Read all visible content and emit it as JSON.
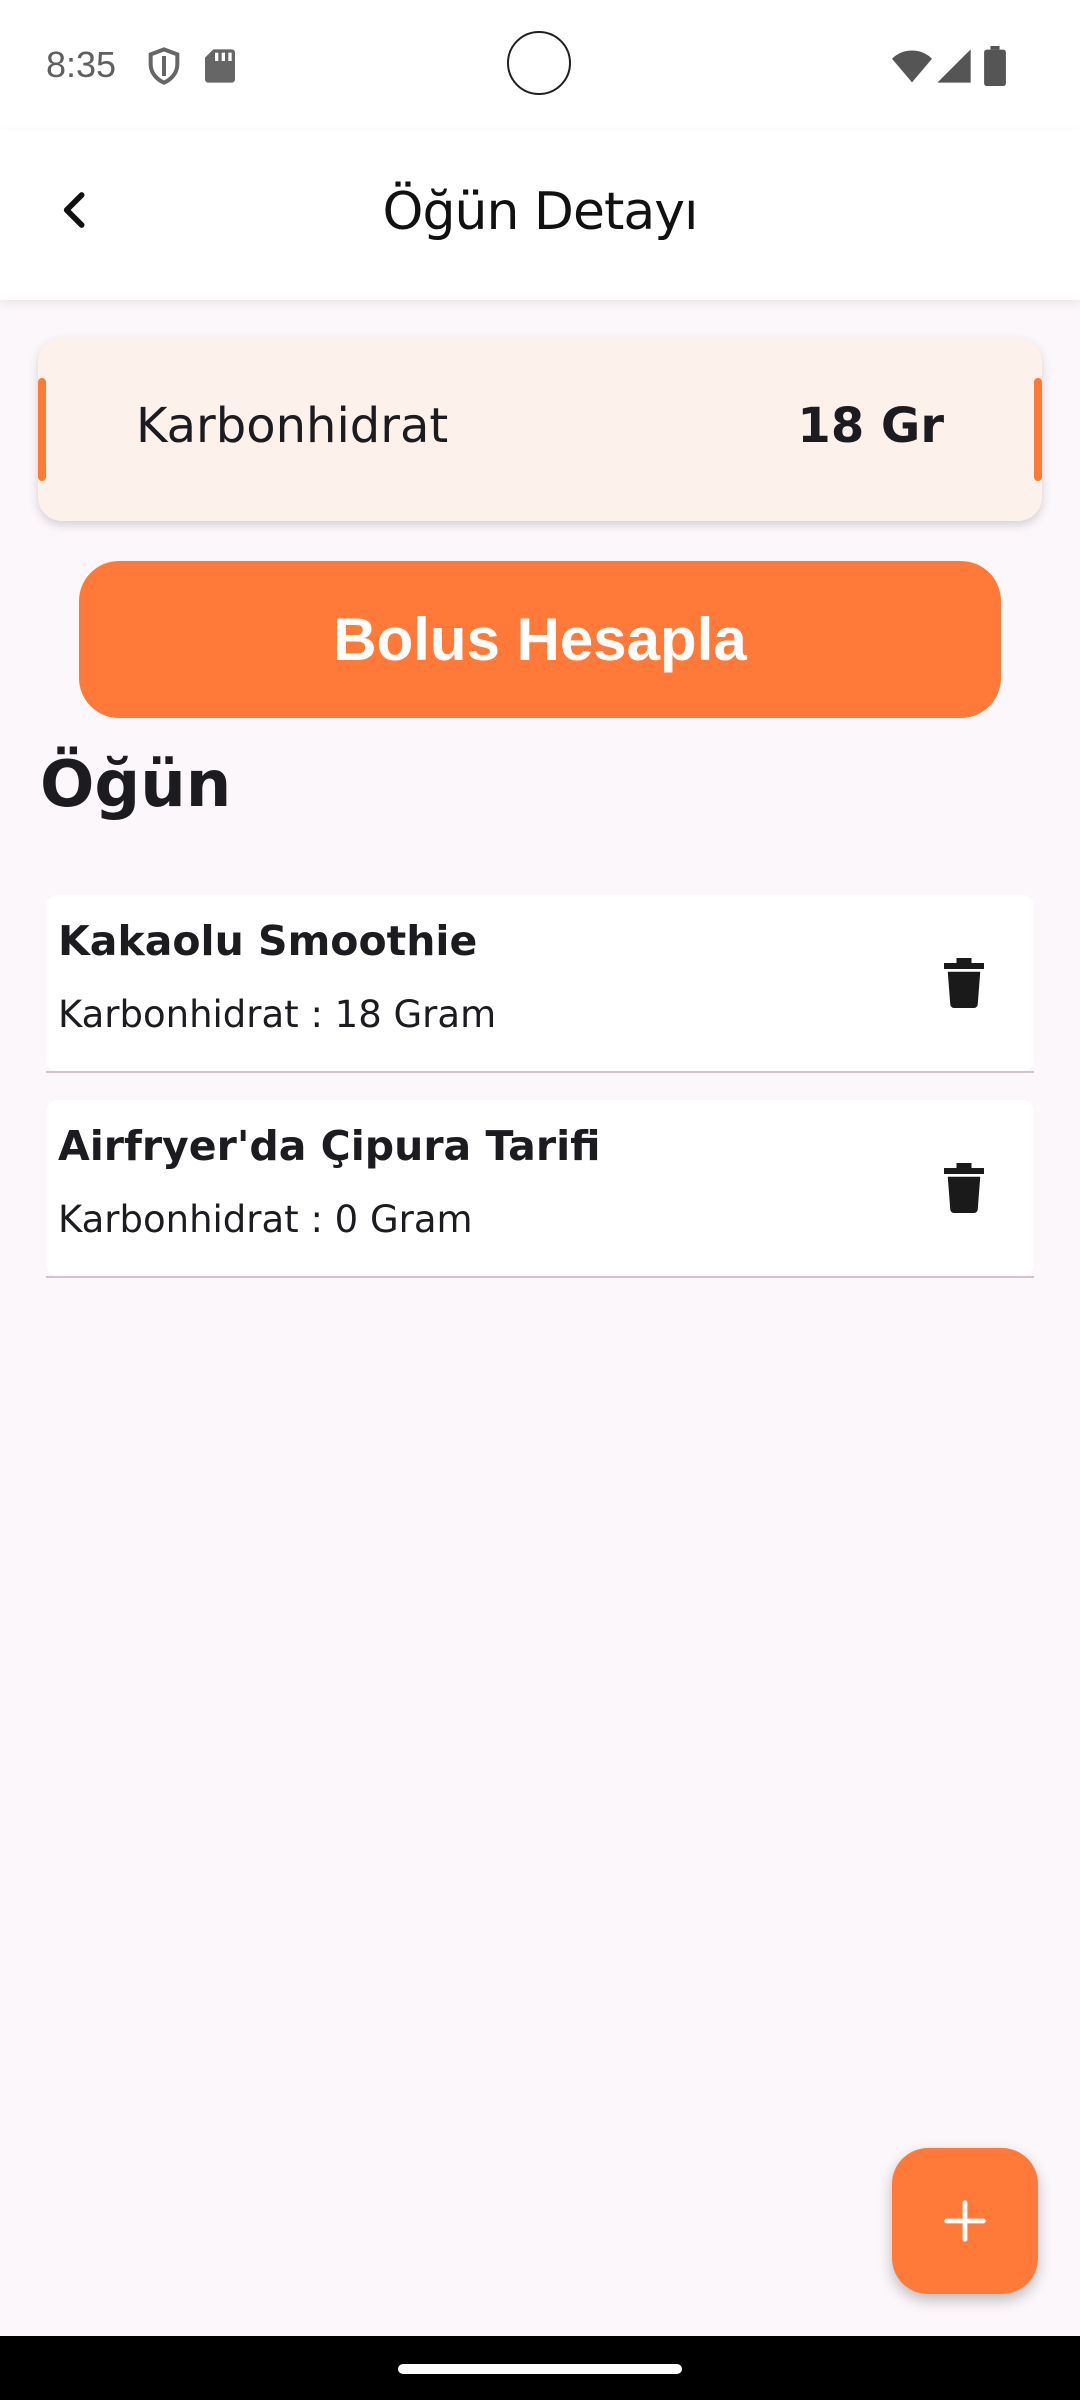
{
  "status_bar": {
    "time": "8:35",
    "icons": [
      "shield-icon",
      "sd-card-icon",
      "wifi-icon",
      "cellular-signal-icon",
      "battery-icon"
    ]
  },
  "app_bar": {
    "title": "Öğün Detayı",
    "back_icon": "chevron-left-icon"
  },
  "carb_summary": {
    "label": "Karbonhidrat",
    "value": "18 Gr",
    "accent_color": "#ff7a33"
  },
  "bolus_button": {
    "label": "Bolus Hesapla",
    "color": "#ff7a38"
  },
  "section": {
    "title": "Öğün"
  },
  "meals": [
    {
      "name": "Kakaolu Smoothie",
      "carb_text": "Karbonhidrat : 18 Gram",
      "action_icon": "trash-icon"
    },
    {
      "name": "Airfryer'da Çipura Tarifi",
      "carb_text": "Karbonhidrat : 0 Gram",
      "action_icon": "trash-icon"
    }
  ],
  "fab": {
    "icon": "plus-icon",
    "color": "#ff7a38"
  }
}
